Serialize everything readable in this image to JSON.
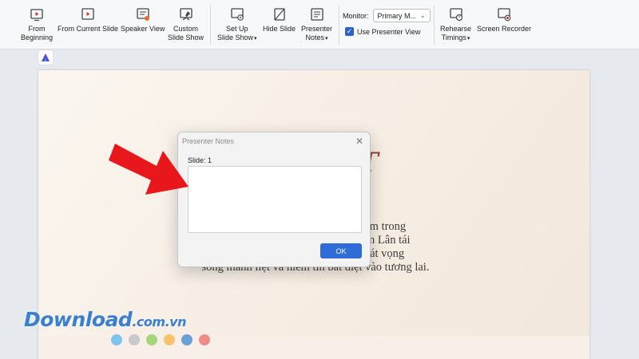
{
  "ribbon": {
    "buttons": [
      {
        "label": "From\nBeginning"
      },
      {
        "label": "From Current Slide"
      },
      {
        "label": "Speaker View"
      },
      {
        "label": "Custom\nSlide Show"
      },
      {
        "label": "Set Up\nSlide Show"
      },
      {
        "label": "Hide Slide"
      },
      {
        "label": "Presenter\nNotes"
      },
      {
        "label": "Rehearse\nTimings"
      },
      {
        "label": "Screen Recorder"
      }
    ],
    "monitor_label": "Monitor:",
    "monitor_value": "Primary M...",
    "presenter_view_label": "Use Presenter View",
    "presenter_view_checked": true
  },
  "slide": {
    "title_fragment": "T",
    "body_lines": [
      "Tác phẩm … nông dân Việt Nam trong",
      "nạn đói k… “nhặt vợ” éo le, Kim Lân tái",
      "hiện sự l… vinh tình người, khát vọng",
      "sống mãnh liệt và niềm tin bất diệt vào tương lai."
    ]
  },
  "dialog": {
    "title": "Presenter Notes",
    "slide_label": "Slide: 1",
    "notes_value": "",
    "ok_label": "OK"
  },
  "watermark": {
    "brand": "Download",
    "suffix": ".com.vn",
    "dot_colors": [
      "#7cc4ec",
      "#c9c9c9",
      "#a6d67a",
      "#f7c46b",
      "#6ba0d6",
      "#f08b8b"
    ]
  },
  "colors": {
    "arrow": "#e8171b",
    "accent": "#2f6cd8",
    "title_red": "#9c3f35"
  }
}
